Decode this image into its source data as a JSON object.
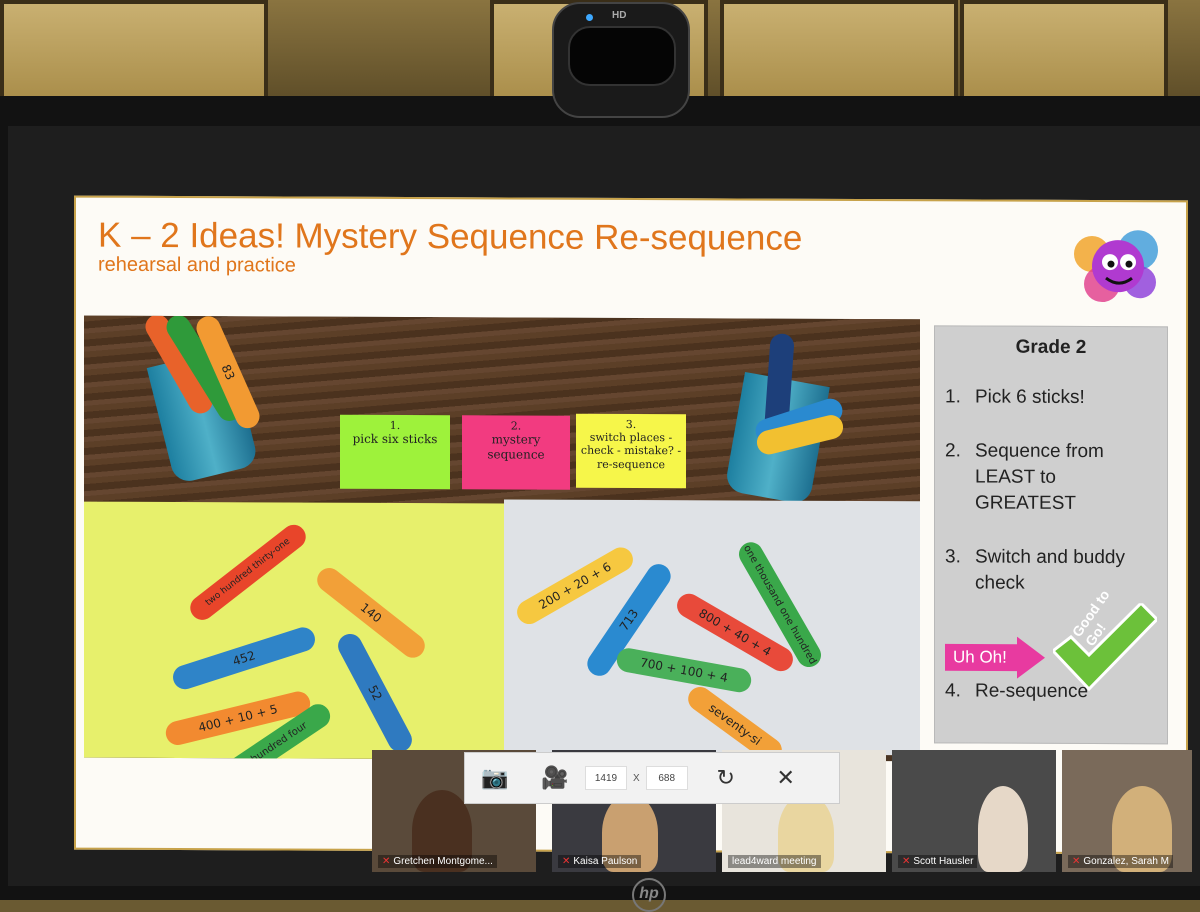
{
  "slide": {
    "title": "K – 2 Ideas! Mystery Sequence Re-sequence",
    "subtitle": "rehearsal and practice",
    "notes": [
      {
        "num": "1.",
        "text": "pick six sticks"
      },
      {
        "num": "2.",
        "text": "mystery sequence"
      },
      {
        "num": "3.",
        "text": "switch places - check - mistake? - re-sequence"
      }
    ],
    "sticks_left": [
      "two hundred thirty-one",
      "140",
      "452",
      "52",
      "400 + 10 + 5",
      "one hundred four"
    ],
    "sticks_right": [
      "200 + 20 + 6",
      "713",
      "one thousand one hundred",
      "800 + 40 + 4",
      "700 + 100 + 4",
      "seventy-si"
    ],
    "cup_stick": "83"
  },
  "panel": {
    "heading": "Grade 2",
    "steps": [
      {
        "num": "1.",
        "text": "Pick 6 sticks!"
      },
      {
        "num": "2.",
        "text": "Sequence from LEAST to GREATEST"
      },
      {
        "num": "3.",
        "text": "Switch and buddy check"
      },
      {
        "num": "4.",
        "text": "Re-sequence"
      }
    ],
    "uh_oh": "Uh Oh!",
    "good": "Good to Go!"
  },
  "toolbar": {
    "width": "1419",
    "sep": "X",
    "height": "688"
  },
  "participants": [
    "Gretchen Montgome...",
    "Kaisa Paulson",
    "lead4ward meeting",
    "Scott Hausler",
    "Gonzalez, Sarah M"
  ],
  "hardware": {
    "webcam_label": "HD",
    "monitor_brand": "hp"
  },
  "colors": {
    "title": "#e0761c",
    "uh_oh": "#e83aa0",
    "good": "#6cc13a"
  }
}
